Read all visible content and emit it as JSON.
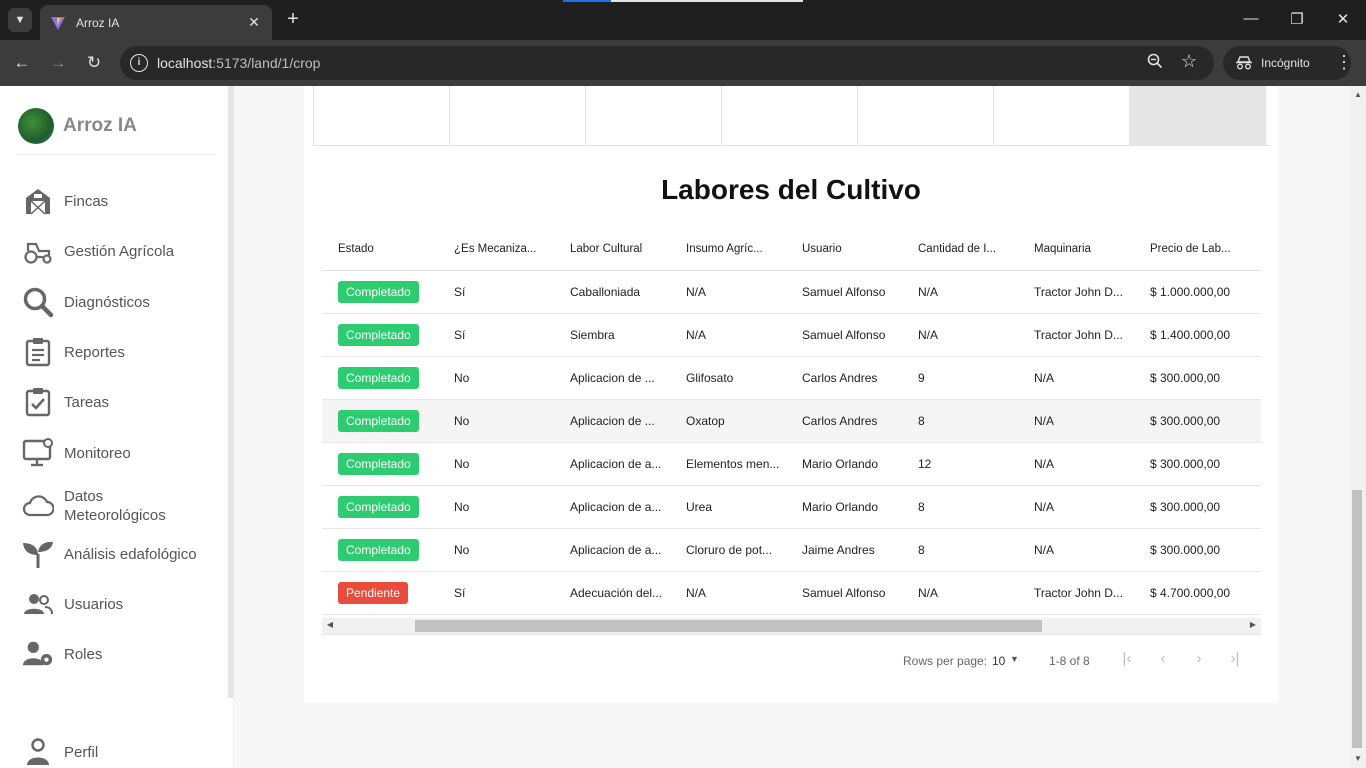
{
  "browser": {
    "tab_title": "Arroz IA",
    "url_host": "localhost",
    "url_path": ":5173/land/1/crop",
    "incognito_label": "Incógnito"
  },
  "sidebar": {
    "brand": "Arroz IA",
    "items": [
      {
        "label": "Fincas",
        "icon": "barn-icon"
      },
      {
        "label": "Gestión Agrícola",
        "icon": "tractor-icon"
      },
      {
        "label": "Diagnósticos",
        "icon": "search-icon"
      },
      {
        "label": "Reportes",
        "icon": "clipboard-icon"
      },
      {
        "label": "Tareas",
        "icon": "checklist-icon"
      },
      {
        "label": "Monitoreo",
        "icon": "monitor-icon"
      },
      {
        "label_line1": "Datos",
        "label_line2": "Meteorológicos",
        "icon": "cloud-icon"
      },
      {
        "label": "Análisis edafológico",
        "icon": "sprout-icon"
      },
      {
        "label": "Usuarios",
        "icon": "users-icon"
      },
      {
        "label": "Roles",
        "icon": "user-gear-icon"
      }
    ],
    "profile": "Perfil"
  },
  "main": {
    "title": "Labores del Cultivo",
    "columns": [
      "Estado",
      "¿Es Mecaniza...",
      "Labor Cultural",
      "Insumo Agríc...",
      "Usuario",
      "Cantidad de I...",
      "Maquinaria",
      "Precio de Lab..."
    ],
    "rows": [
      {
        "estado": "Completado",
        "mecanizada": "Sí",
        "labor": "Caballoniada",
        "insumo": "N/A",
        "usuario": "Samuel Alfonso",
        "cantidad": "N/A",
        "maquinaria": "Tractor John D...",
        "precio": "$ 1.000.000,00"
      },
      {
        "estado": "Completado",
        "mecanizada": "Sí",
        "labor": "Siembra",
        "insumo": "N/A",
        "usuario": "Samuel Alfonso",
        "cantidad": "N/A",
        "maquinaria": "Tractor John D...",
        "precio": "$ 1.400.000,00"
      },
      {
        "estado": "Completado",
        "mecanizada": "No",
        "labor": "Aplicacion de ...",
        "insumo": "Glifosato",
        "usuario": "Carlos Andres",
        "cantidad": "9",
        "maquinaria": "N/A",
        "precio": "$ 300.000,00"
      },
      {
        "estado": "Completado",
        "mecanizada": "No",
        "labor": "Aplicacion de ...",
        "insumo": "Oxatop",
        "usuario": "Carlos Andres",
        "cantidad": "8",
        "maquinaria": "N/A",
        "precio": "$ 300.000,00"
      },
      {
        "estado": "Completado",
        "mecanizada": "No",
        "labor": "Aplicacion de a...",
        "insumo": "Elementos men...",
        "usuario": "Mario Orlando",
        "cantidad": "12",
        "maquinaria": "N/A",
        "precio": "$ 300.000,00"
      },
      {
        "estado": "Completado",
        "mecanizada": "No",
        "labor": "Aplicacion de a...",
        "insumo": "Urea",
        "usuario": "Mario Orlando",
        "cantidad": "8",
        "maquinaria": "N/A",
        "precio": "$ 300.000,00"
      },
      {
        "estado": "Completado",
        "mecanizada": "No",
        "labor": "Aplicacion de a...",
        "insumo": "Cloruro de pot...",
        "usuario": "Jaime Andres",
        "cantidad": "8",
        "maquinaria": "N/A",
        "precio": "$ 300.000,00"
      },
      {
        "estado": "Pendiente",
        "mecanizada": "Sí",
        "labor": "Adecuación del...",
        "insumo": "N/A",
        "usuario": "Samuel Alfonso",
        "cantidad": "N/A",
        "maquinaria": "Tractor John D...",
        "precio": "$ 4.700.000,00"
      }
    ],
    "pagination": {
      "rows_per_page_label": "Rows per page:",
      "rows_per_page": "10",
      "range": "1-8 of 8"
    }
  },
  "colors": {
    "completed": "#2ecc71",
    "pending": "#e74c3c"
  }
}
